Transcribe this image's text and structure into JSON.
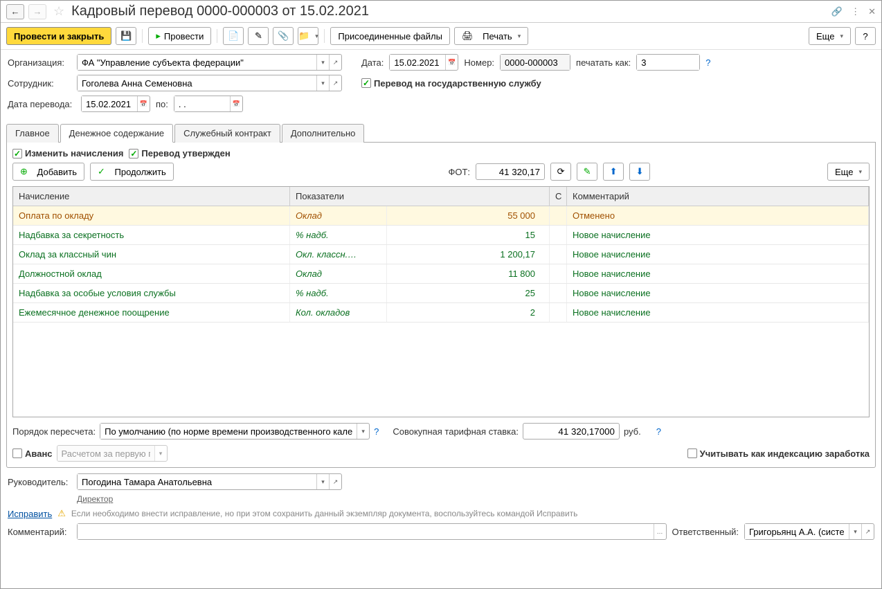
{
  "title": "Кадровый перевод 0000-000003 от 15.02.2021",
  "toolbar": {
    "post_close": "Провести и закрыть",
    "post": "Провести",
    "attached": "Присоединенные файлы",
    "print": "Печать",
    "more": "Еще",
    "help": "?"
  },
  "form": {
    "org_label": "Организация:",
    "org_value": "ФА \"Управление субъекта федерации\"",
    "date_label": "Дата:",
    "date_value": "15.02.2021",
    "number_label": "Номер:",
    "number_value": "0000-000003",
    "printas_label": "печатать как:",
    "printas_value": "3",
    "employee_label": "Сотрудник:",
    "employee_value": "Гоголева Анна Семеновна",
    "gov_transfer": "Перевод на государственную службу",
    "transfer_date_label": "Дата перевода:",
    "transfer_date_value": "15.02.2021",
    "to_label": "по:",
    "to_value": ". ."
  },
  "tabs": [
    "Главное",
    "Денежное содержание",
    "Служебный контракт",
    "Дополнительно"
  ],
  "tab_active": 1,
  "tab2": {
    "change_accruals": "Изменить начисления",
    "transfer_approved": "Перевод утвержден",
    "add": "Добавить",
    "continue": "Продолжить",
    "fot_label": "ФОТ:",
    "fot_value": "41 320,17",
    "more": "Еще",
    "grid_headers": [
      "Начисление",
      "Показатели",
      "С",
      "Комментарий"
    ],
    "rows": [
      {
        "accrual": "Оплата по окладу",
        "indicator": "Оклад",
        "value": "55 000",
        "comment": "Отменено",
        "kind": "cancel"
      },
      {
        "accrual": "Надбавка за секретность",
        "indicator": "% надб.",
        "value": "15",
        "comment": "Новое начисление",
        "kind": "new"
      },
      {
        "accrual": "Оклад за классный чин",
        "indicator": "Окл. классн.…",
        "value": "1 200,17",
        "comment": "Новое начисление",
        "kind": "new"
      },
      {
        "accrual": "Должностной оклад",
        "indicator": "Оклад",
        "value": "11 800",
        "comment": "Новое начисление",
        "kind": "new"
      },
      {
        "accrual": "Надбавка за особые условия службы",
        "indicator": "% надб.",
        "value": "25",
        "comment": "Новое начисление",
        "kind": "new"
      },
      {
        "accrual": "Ежемесячное денежное поощрение",
        "indicator": "Кол. окладов",
        "value": "2",
        "comment": "Новое начисление",
        "kind": "new"
      }
    ],
    "recalc_label": "Порядок пересчета:",
    "recalc_value": "По умолчанию (по норме времени производственного календар",
    "rate_label": "Совокупная тарифная ставка:",
    "rate_value": "41 320,17000",
    "rate_unit": "руб.",
    "advance_label": "Аванс",
    "advance_value": "Расчетом за первую поло",
    "index_label": "Учитывать как индексацию заработка"
  },
  "footer": {
    "manager_label": "Руководитель:",
    "manager_value": "Погодина Тамара Анатольевна",
    "manager_role": "Директор",
    "fix_link": "Исправить",
    "fix_hint": "Если необходимо внести исправление, но при этом сохранить данный экземпляр документа, воспользуйтесь командой Исправить",
    "comment_label": "Комментарий:",
    "resp_label": "Ответственный:",
    "resp_value": "Григорьянц А.А. (системн"
  }
}
